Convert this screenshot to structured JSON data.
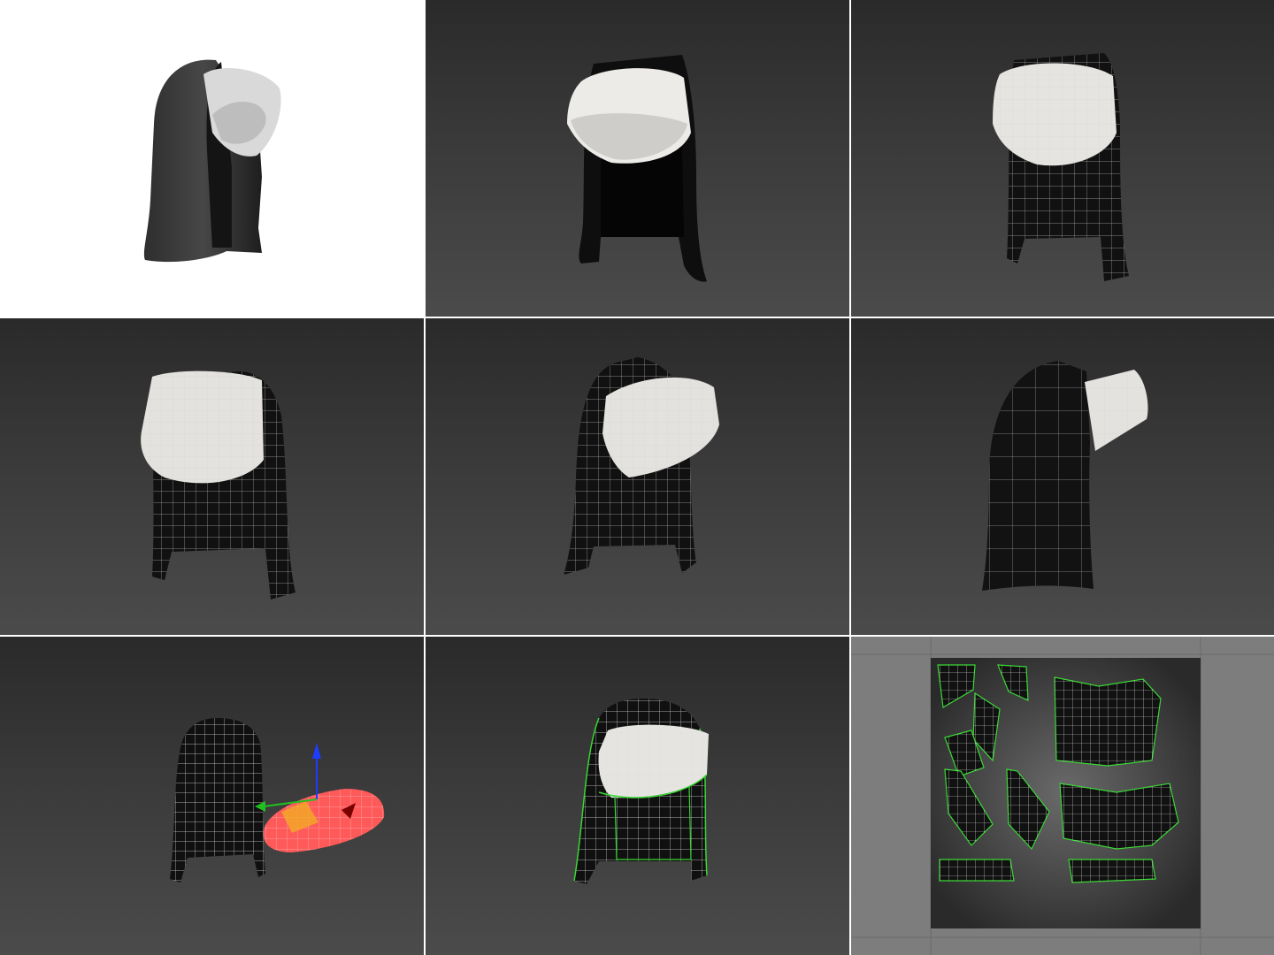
{
  "gallery": {
    "panels": [
      {
        "id": "render-studio",
        "background": "white",
        "shading": "smooth"
      },
      {
        "id": "render-viewport-front",
        "background": "viewport",
        "shading": "smooth"
      },
      {
        "id": "wireframe-front",
        "background": "viewport",
        "shading": "wireframe-on-shaded"
      },
      {
        "id": "wireframe-front-left",
        "background": "viewport",
        "shading": "wireframe-on-shaded"
      },
      {
        "id": "wireframe-front-right",
        "background": "viewport",
        "shading": "wireframe-on-shaded"
      },
      {
        "id": "wireframe-side",
        "background": "viewport",
        "shading": "wireframe-on-shaded"
      },
      {
        "id": "parts-separated-gizmo",
        "background": "viewport",
        "shading": "wireframe",
        "selection_color": "#ff4a4a"
      },
      {
        "id": "uv-seams",
        "background": "viewport",
        "shading": "wireframe",
        "seam_color": "#39d833"
      },
      {
        "id": "uv-layout",
        "background": "uv-editor",
        "shading": "uv-islands",
        "island_edge_color": "#39d833"
      }
    ],
    "colors": {
      "viewport_top": "#2a2a2a",
      "viewport_bottom": "#4b4b4b",
      "cloth_black": "#121212",
      "cloth_white": "#e8e6e3",
      "wire": "#d8d8d8",
      "seam_green": "#39d833",
      "gizmo_blue": "#1f3cff",
      "gizmo_green": "#21c021",
      "gizmo_red": "#e02020",
      "gizmo_plane": "#f0b020"
    }
  }
}
